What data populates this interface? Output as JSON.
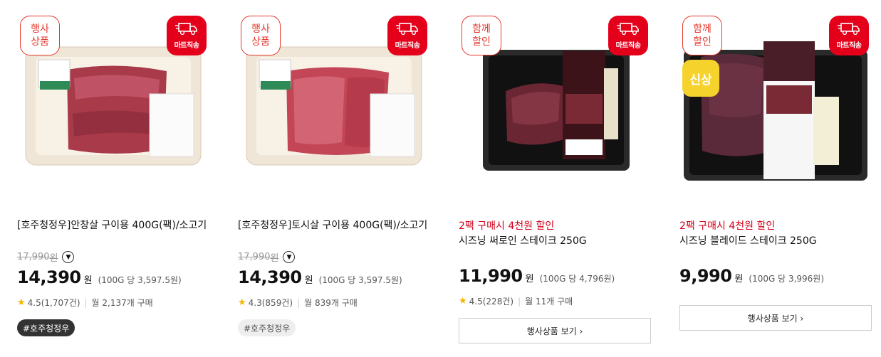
{
  "products": [
    {
      "badge_left": "행사\n상품",
      "badge_right": "마트직송",
      "promo": "",
      "title": "[호주청정우]안창살 구이용 400G(팩)/소고기",
      "original_price": "17,990",
      "original_currency": "원",
      "price": "14,390",
      "currency": "원",
      "unit_price": "(100G 당 3,597.5원)",
      "rating": "4.5(1,707건)",
      "monthly": "월 2,137개 구매",
      "tag": "#호주청정우",
      "tag_style": "dark"
    },
    {
      "badge_left": "행사\n상품",
      "badge_right": "마트직송",
      "promo": "",
      "title": "[호주청정우]토시살 구이용 400G(팩)/소고기",
      "original_price": "17,990",
      "original_currency": "원",
      "price": "14,390",
      "currency": "원",
      "unit_price": "(100G 당 3,597.5원)",
      "rating": "4.3(859건)",
      "monthly": "월 839개 구매",
      "tag": "#호주청정우",
      "tag_style": "light"
    },
    {
      "badge_left": "함께\n할인",
      "badge_right": "마트직송",
      "promo": "2팩 구매시 4천원 할인",
      "title": "시즈닝 써로인 스테이크 250G",
      "price": "11,990",
      "currency": "원",
      "unit_price": "(100G 당 4,796원)",
      "rating": "4.5(228건)",
      "monthly": "월 11개 구매",
      "button": "행사상품 보기 ›"
    },
    {
      "badge_left": "함께\n할인",
      "badge_right": "마트직송",
      "new_badge": "신상",
      "promo": "2팩 구매시 4천원 할인",
      "title": "시즈닝 블레이드 스테이크 250G",
      "price": "9,990",
      "currency": "원",
      "unit_price": "(100G 당 3,996원)",
      "button": "행사상품 보기 ›"
    }
  ],
  "colors": {
    "accent_red": "#e4001b",
    "promo_red": "#d5001b",
    "star": "#f4b400"
  },
  "icons": {
    "delivery": "delivery-truck-icon",
    "star": "star-icon",
    "info": "chevron-down-circle-icon"
  }
}
